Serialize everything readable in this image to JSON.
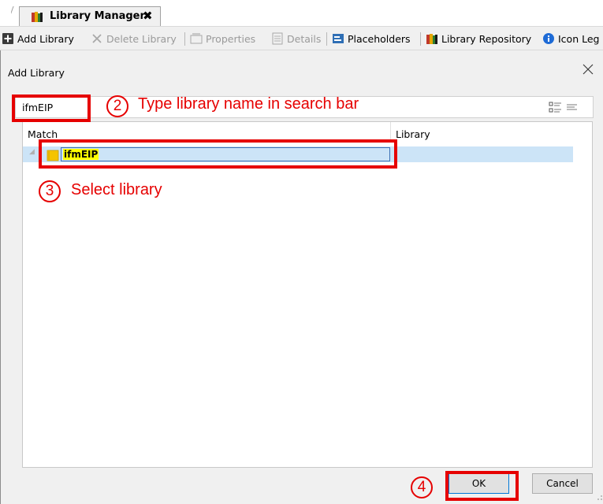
{
  "tab": {
    "title": "Library Manager",
    "close": "✖"
  },
  "toolbar": {
    "add_library": "Add Library",
    "delete_library": "Delete Library",
    "properties": "Properties",
    "details": "Details",
    "placeholders": "Placeholders",
    "library_repository": "Library Repository",
    "icon_legend": "Icon Leg"
  },
  "dialog": {
    "title": "Add Library",
    "search": {
      "value": "ifmEIP"
    },
    "columns": {
      "match": "Match",
      "library": "Library"
    },
    "results": [
      {
        "name": "ifmEIP"
      }
    ],
    "ok": "OK",
    "cancel": "Cancel"
  },
  "annotations": {
    "step2": {
      "number": "2",
      "text": "Type library name in search bar"
    },
    "step3": {
      "number": "3",
      "text": "Select library"
    },
    "step4": {
      "number": "4"
    }
  },
  "colors": {
    "annotation": "#e60000",
    "selection": "#cce4f7",
    "highlight": "#ffff00"
  }
}
